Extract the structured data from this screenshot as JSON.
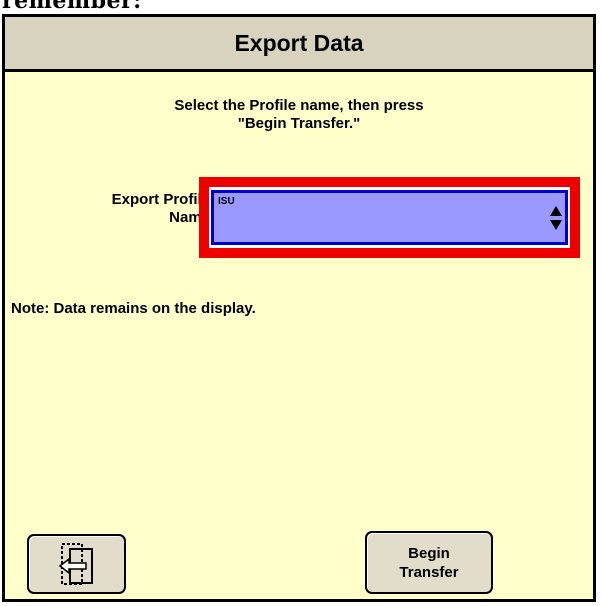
{
  "page_header_fragment": "remember:",
  "window": {
    "title": "Export Data",
    "instruction": "Select the Profile name, then press\n\"Begin Transfer.\"",
    "export_profile": {
      "label": "Export Profile\nName",
      "value": "ISU"
    },
    "note": "Note: Data remains on the display.",
    "buttons": {
      "back_icon": "exit-door-icon",
      "begin_transfer_label": "Begin\nTransfer"
    }
  },
  "colors": {
    "panel_background": "#ffffcc",
    "title_bar": "#d7d3bf",
    "dropdown_fill": "#9999ff",
    "dropdown_border": "#0000cc",
    "highlight": "#ee0000",
    "button_fill": "#e2ddcb"
  }
}
